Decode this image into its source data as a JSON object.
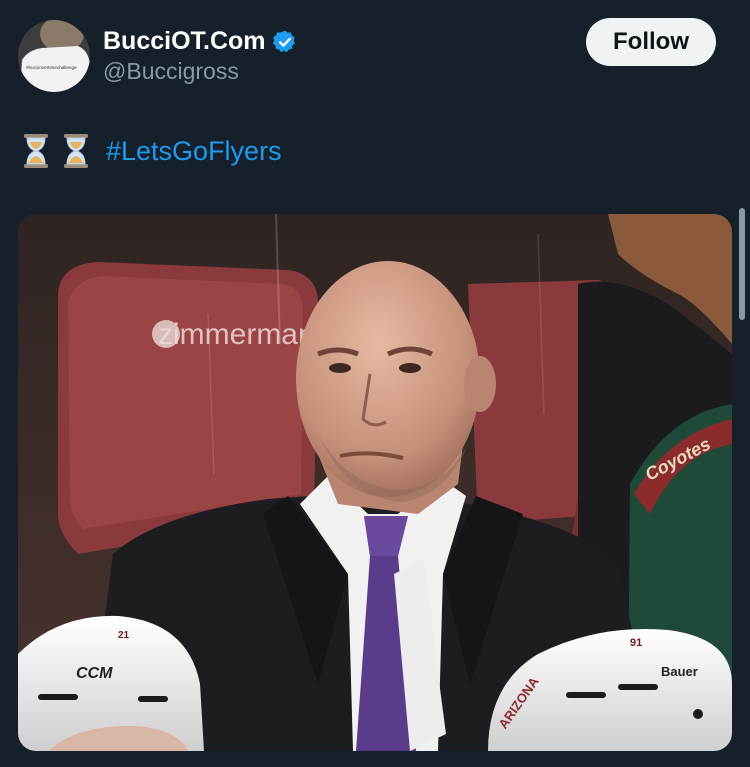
{
  "tweet": {
    "author": {
      "display_name": "BucciOT.Com",
      "handle": "@Buccigross",
      "verified": true,
      "avatar_shirt_text": "#bucciovertimechallenge"
    },
    "follow_label": "Follow",
    "text": {
      "emojis": [
        "hourglass-icon",
        "hourglass-icon"
      ],
      "hashtag": "#LetsGoFlyers"
    },
    "media": {
      "seat_logo_text": "zimmerman",
      "helmet_left_brand": "CCM",
      "helmet_left_number": "21",
      "helmet_right_brand": "Bauer",
      "helmet_right_number": "91",
      "helmet_right_team_text": "ARIZONA",
      "jersey_text": "Coyotes"
    }
  },
  "colors": {
    "background": "#15202b",
    "accent": "#1d9bf0",
    "verified": "#1d9bf0",
    "follow_bg": "#eff3f4",
    "handle": "#8b98a5"
  }
}
